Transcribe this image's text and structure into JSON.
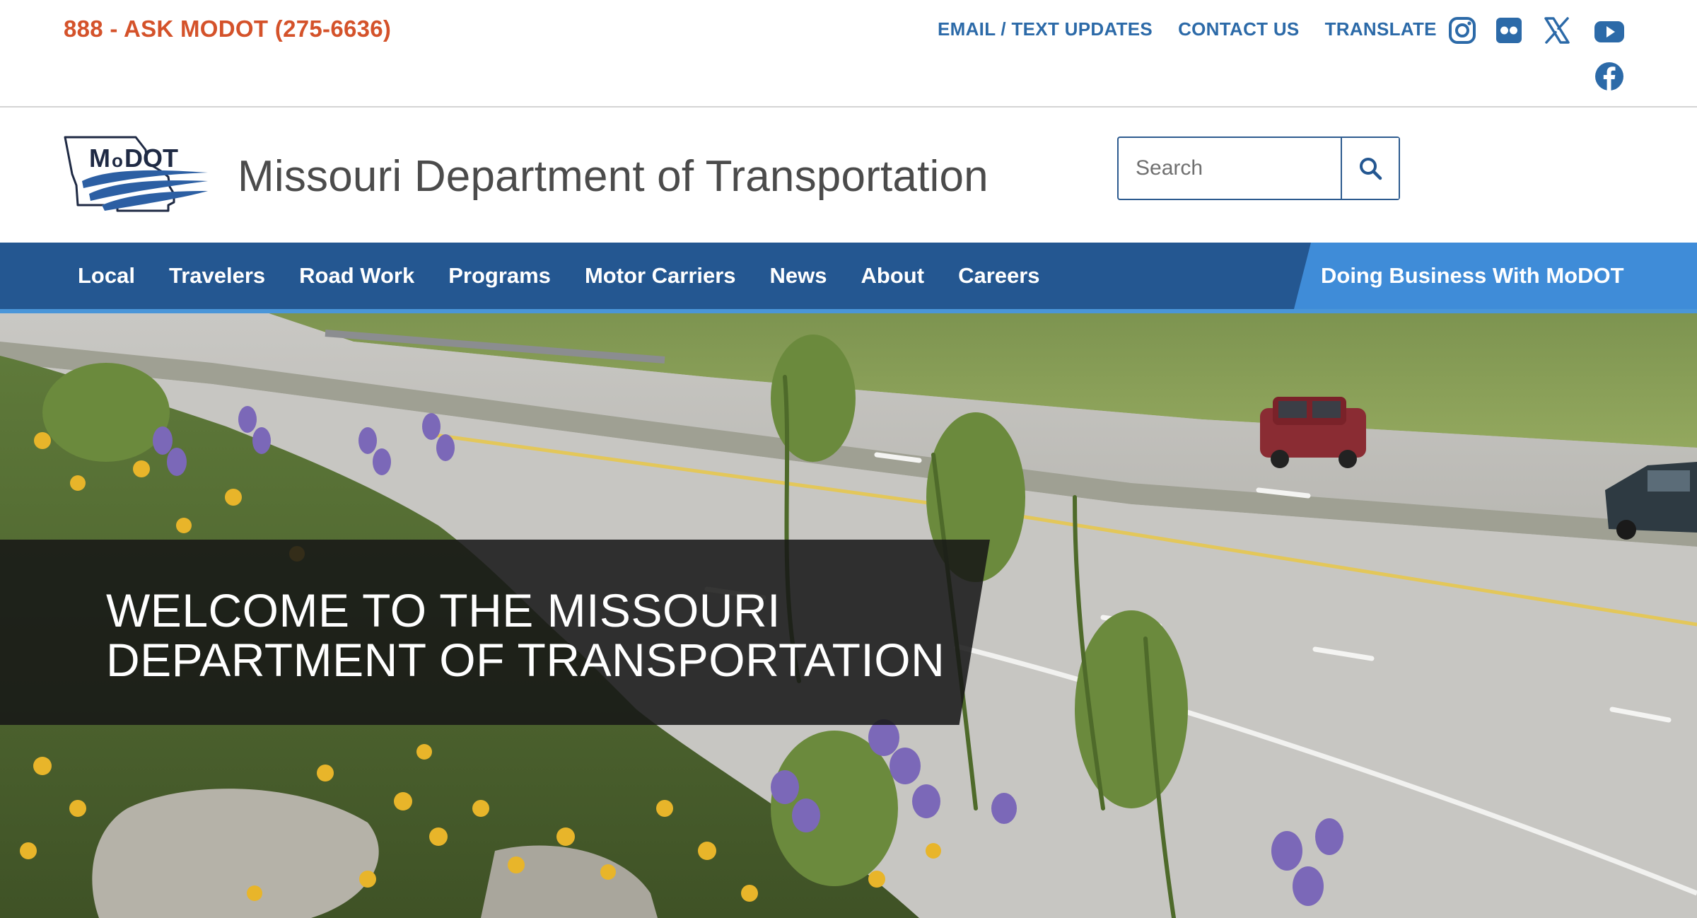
{
  "utility": {
    "phone": "888 - ASK MODOT (275-6636)",
    "links": [
      "EMAIL / TEXT UPDATES",
      "CONTACT US",
      "TRANSLATE"
    ],
    "social_icons": [
      "instagram-icon",
      "flickr-icon",
      "x-icon",
      "youtube-icon",
      "facebook-icon"
    ]
  },
  "header": {
    "logo_text": "MoDOT",
    "title": "Missouri Department of Transportation",
    "search_placeholder": "Search"
  },
  "nav": {
    "items": [
      "Local",
      "Travelers",
      "Road Work",
      "Programs",
      "Motor Carriers",
      "News",
      "About",
      "Careers"
    ],
    "business": "Doing Business With MoDOT"
  },
  "hero": {
    "line1": "WELCOME TO THE MISSOURI",
    "line2": "DEPARTMENT OF TRANSPORTATION"
  },
  "colors": {
    "phone": "#d4522a",
    "links": "#2c6aa8",
    "nav": "#245791",
    "nav_accent": "#3f8cd8"
  }
}
